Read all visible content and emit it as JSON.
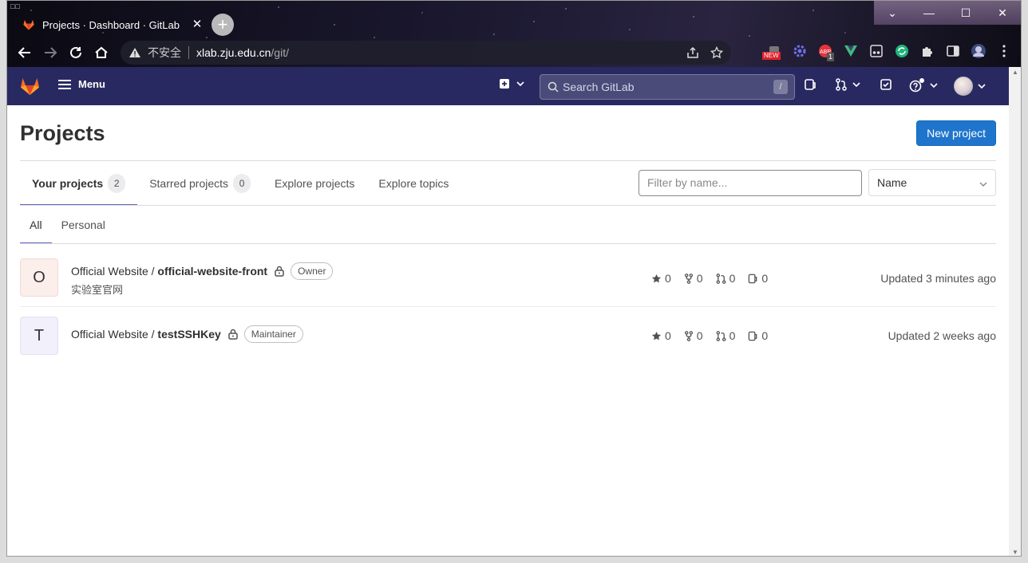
{
  "browser": {
    "tab_title": "Projects · Dashboard · GitLab",
    "url_insecure_label": "不安全",
    "url_host": "xlab.zju.edu.cn",
    "url_path": "/git/",
    "ext_new_badge": "NEW",
    "ext_count_badge": "1"
  },
  "header": {
    "menu_label": "Menu",
    "search_placeholder": "Search GitLab",
    "search_shortcut": "/"
  },
  "page": {
    "title": "Projects",
    "new_project_label": "New project",
    "tabs": [
      {
        "label": "Your projects",
        "count": "2"
      },
      {
        "label": "Starred projects",
        "count": "0"
      },
      {
        "label": "Explore projects"
      },
      {
        "label": "Explore topics"
      }
    ],
    "filter_placeholder": "Filter by name...",
    "sort_value": "Name",
    "subtabs": [
      "All",
      "Personal"
    ]
  },
  "projects": [
    {
      "avatar_letter": "O",
      "namespace": "Official Website / ",
      "name": "official-website-front",
      "role": "Owner",
      "description": "实验室官网",
      "stars": "0",
      "forks": "0",
      "merge_requests": "0",
      "issues": "0",
      "updated": "Updated 3 minutes ago"
    },
    {
      "avatar_letter": "T",
      "namespace": "Official Website / ",
      "name": "testSSHKey",
      "role": "Maintainer",
      "stars": "0",
      "forks": "0",
      "merge_requests": "0",
      "issues": "0",
      "updated": "Updated 2 weeks ago"
    }
  ],
  "colors": {
    "header_bg": "#292961",
    "primary_button": "#1f75cb",
    "tab_underline": "#6666c4"
  }
}
